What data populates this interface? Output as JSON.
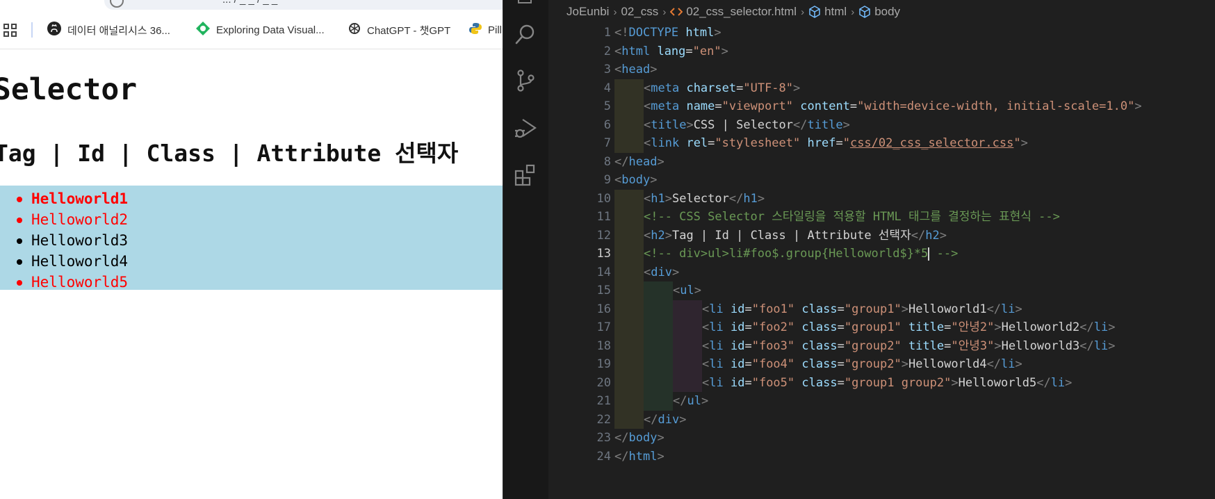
{
  "browser": {
    "url_text": "... / _ _ / _ _",
    "bookmarks": [
      {
        "label": "데이터 애널리시스 36...",
        "icon": "github-icon"
      },
      {
        "label": "Exploring Data Visual...",
        "icon": "green-diamond-icon"
      },
      {
        "label": "ChatGPT - 챗GPT",
        "icon": "openai-icon"
      },
      {
        "label": "Pill",
        "icon": "python-icon"
      }
    ],
    "page": {
      "h1": "Selector",
      "h2": "Tag | Id | Class | Attribute 선택자",
      "list_bg": "#add8e6",
      "items": [
        {
          "text": "Helloworld1",
          "color": "#ff0000",
          "bold": true
        },
        {
          "text": "Helloworld2",
          "color": "#ff0000",
          "bold": false
        },
        {
          "text": "Helloworld3",
          "color": "#000000",
          "bold": false
        },
        {
          "text": "Helloworld4",
          "color": "#000000",
          "bold": false
        },
        {
          "text": "Helloworld5",
          "color": "#ff0000",
          "bold": false
        }
      ]
    }
  },
  "vscode": {
    "breadcrumbs": [
      "JoEunbi",
      "02_css",
      "02_css_selector.html",
      "html",
      "body"
    ],
    "active_line": 13,
    "lines": [
      {
        "n": 1,
        "indent": 0,
        "tokens": [
          [
            "p",
            "<!"
          ],
          [
            "t",
            "DOCTYPE"
          ],
          [
            "x",
            " "
          ],
          [
            "a",
            "html"
          ],
          [
            "p",
            ">"
          ]
        ]
      },
      {
        "n": 2,
        "indent": 0,
        "tokens": [
          [
            "p",
            "<"
          ],
          [
            "t",
            "html"
          ],
          [
            "x",
            " "
          ],
          [
            "a",
            "lang"
          ],
          [
            "x",
            "="
          ],
          [
            "s",
            "\"en\""
          ],
          [
            "p",
            ">"
          ]
        ]
      },
      {
        "n": 3,
        "indent": 0,
        "tokens": [
          [
            "p",
            "<"
          ],
          [
            "t",
            "head"
          ],
          [
            "p",
            ">"
          ]
        ]
      },
      {
        "n": 4,
        "indent": 1,
        "tokens": [
          [
            "p",
            "<"
          ],
          [
            "t",
            "meta"
          ],
          [
            "x",
            " "
          ],
          [
            "a",
            "charset"
          ],
          [
            "x",
            "="
          ],
          [
            "s",
            "\"UTF-8\""
          ],
          [
            "p",
            ">"
          ]
        ]
      },
      {
        "n": 5,
        "indent": 1,
        "tokens": [
          [
            "p",
            "<"
          ],
          [
            "t",
            "meta"
          ],
          [
            "x",
            " "
          ],
          [
            "a",
            "name"
          ],
          [
            "x",
            "="
          ],
          [
            "s",
            "\"viewport\""
          ],
          [
            "x",
            " "
          ],
          [
            "a",
            "content"
          ],
          [
            "x",
            "="
          ],
          [
            "s",
            "\"width=device-width, initial-scale=1.0\""
          ],
          [
            "p",
            ">"
          ]
        ]
      },
      {
        "n": 6,
        "indent": 1,
        "tokens": [
          [
            "p",
            "<"
          ],
          [
            "t",
            "title"
          ],
          [
            "p",
            ">"
          ],
          [
            "x",
            "CSS | Selector"
          ],
          [
            "p",
            "</"
          ],
          [
            "t",
            "title"
          ],
          [
            "p",
            ">"
          ]
        ]
      },
      {
        "n": 7,
        "indent": 1,
        "tokens": [
          [
            "p",
            "<"
          ],
          [
            "t",
            "link"
          ],
          [
            "x",
            " "
          ],
          [
            "a",
            "rel"
          ],
          [
            "x",
            "="
          ],
          [
            "s",
            "\"stylesheet\""
          ],
          [
            "x",
            " "
          ],
          [
            "a",
            "href"
          ],
          [
            "x",
            "="
          ],
          [
            "s",
            "\""
          ],
          [
            "su",
            "css/02_css_selector.css"
          ],
          [
            "s",
            "\""
          ],
          [
            "p",
            ">"
          ]
        ]
      },
      {
        "n": 8,
        "indent": 0,
        "tokens": [
          [
            "p",
            "</"
          ],
          [
            "t",
            "head"
          ],
          [
            "p",
            ">"
          ]
        ]
      },
      {
        "n": 9,
        "indent": 0,
        "tokens": [
          [
            "p",
            "<"
          ],
          [
            "t",
            "body"
          ],
          [
            "p",
            ">"
          ]
        ]
      },
      {
        "n": 10,
        "indent": 1,
        "tokens": [
          [
            "p",
            "<"
          ],
          [
            "t",
            "h1"
          ],
          [
            "p",
            ">"
          ],
          [
            "x",
            "Selector"
          ],
          [
            "p",
            "</"
          ],
          [
            "t",
            "h1"
          ],
          [
            "p",
            ">"
          ]
        ]
      },
      {
        "n": 11,
        "indent": 1,
        "tokens": [
          [
            "c",
            "<!-- CSS Selector 스타일링을 적용할 HTML 태그를 결정하는 표현식 -->"
          ]
        ]
      },
      {
        "n": 12,
        "indent": 1,
        "tokens": [
          [
            "p",
            "<"
          ],
          [
            "t",
            "h2"
          ],
          [
            "p",
            ">"
          ],
          [
            "x",
            "Tag | Id | Class | Attribute 선택자"
          ],
          [
            "p",
            "</"
          ],
          [
            "t",
            "h2"
          ],
          [
            "p",
            ">"
          ]
        ]
      },
      {
        "n": 13,
        "indent": 1,
        "tokens": [
          [
            "c",
            "<!-- div>ul>li#foo$.group{Helloworld$}*5"
          ],
          [
            "cursor",
            ""
          ],
          [
            "c",
            " -->"
          ]
        ]
      },
      {
        "n": 14,
        "indent": 1,
        "tokens": [
          [
            "p",
            "<"
          ],
          [
            "t",
            "div"
          ],
          [
            "p",
            ">"
          ]
        ]
      },
      {
        "n": 15,
        "indent": 2,
        "tokens": [
          [
            "p",
            "<"
          ],
          [
            "t",
            "ul"
          ],
          [
            "p",
            ">"
          ]
        ]
      },
      {
        "n": 16,
        "indent": 3,
        "tokens": [
          [
            "p",
            "<"
          ],
          [
            "t",
            "li"
          ],
          [
            "x",
            " "
          ],
          [
            "a",
            "id"
          ],
          [
            "x",
            "="
          ],
          [
            "s",
            "\"foo1\""
          ],
          [
            "x",
            " "
          ],
          [
            "a",
            "class"
          ],
          [
            "x",
            "="
          ],
          [
            "s",
            "\"group1\""
          ],
          [
            "p",
            ">"
          ],
          [
            "x",
            "Helloworld1"
          ],
          [
            "p",
            "</"
          ],
          [
            "t",
            "li"
          ],
          [
            "p",
            ">"
          ]
        ]
      },
      {
        "n": 17,
        "indent": 3,
        "tokens": [
          [
            "p",
            "<"
          ],
          [
            "t",
            "li"
          ],
          [
            "x",
            " "
          ],
          [
            "a",
            "id"
          ],
          [
            "x",
            "="
          ],
          [
            "s",
            "\"foo2\""
          ],
          [
            "x",
            " "
          ],
          [
            "a",
            "class"
          ],
          [
            "x",
            "="
          ],
          [
            "s",
            "\"group1\""
          ],
          [
            "x",
            " "
          ],
          [
            "a",
            "title"
          ],
          [
            "x",
            "="
          ],
          [
            "s",
            "\"안녕2\""
          ],
          [
            "p",
            ">"
          ],
          [
            "x",
            "Helloworld2"
          ],
          [
            "p",
            "</"
          ],
          [
            "t",
            "li"
          ],
          [
            "p",
            ">"
          ]
        ]
      },
      {
        "n": 18,
        "indent": 3,
        "tokens": [
          [
            "p",
            "<"
          ],
          [
            "t",
            "li"
          ],
          [
            "x",
            " "
          ],
          [
            "a",
            "id"
          ],
          [
            "x",
            "="
          ],
          [
            "s",
            "\"foo3\""
          ],
          [
            "x",
            " "
          ],
          [
            "a",
            "class"
          ],
          [
            "x",
            "="
          ],
          [
            "s",
            "\"group2\""
          ],
          [
            "x",
            " "
          ],
          [
            "a",
            "title"
          ],
          [
            "x",
            "="
          ],
          [
            "s",
            "\"안녕3\""
          ],
          [
            "p",
            ">"
          ],
          [
            "x",
            "Helloworld3"
          ],
          [
            "p",
            "</"
          ],
          [
            "t",
            "li"
          ],
          [
            "p",
            ">"
          ]
        ]
      },
      {
        "n": 19,
        "indent": 3,
        "tokens": [
          [
            "p",
            "<"
          ],
          [
            "t",
            "li"
          ],
          [
            "x",
            " "
          ],
          [
            "a",
            "id"
          ],
          [
            "x",
            "="
          ],
          [
            "s",
            "\"foo4\""
          ],
          [
            "x",
            " "
          ],
          [
            "a",
            "class"
          ],
          [
            "x",
            "="
          ],
          [
            "s",
            "\"group2\""
          ],
          [
            "p",
            ">"
          ],
          [
            "x",
            "Helloworld4"
          ],
          [
            "p",
            "</"
          ],
          [
            "t",
            "li"
          ],
          [
            "p",
            ">"
          ]
        ]
      },
      {
        "n": 20,
        "indent": 3,
        "tokens": [
          [
            "p",
            "<"
          ],
          [
            "t",
            "li"
          ],
          [
            "x",
            " "
          ],
          [
            "a",
            "id"
          ],
          [
            "x",
            "="
          ],
          [
            "s",
            "\"foo5\""
          ],
          [
            "x",
            " "
          ],
          [
            "a",
            "class"
          ],
          [
            "x",
            "="
          ],
          [
            "s",
            "\"group1 group2\""
          ],
          [
            "p",
            ">"
          ],
          [
            "x",
            "Helloworld5"
          ],
          [
            "p",
            "</"
          ],
          [
            "t",
            "li"
          ],
          [
            "p",
            ">"
          ]
        ]
      },
      {
        "n": 21,
        "indent": 2,
        "tokens": [
          [
            "p",
            "</"
          ],
          [
            "t",
            "ul"
          ],
          [
            "p",
            ">"
          ]
        ]
      },
      {
        "n": 22,
        "indent": 1,
        "tokens": [
          [
            "p",
            "</"
          ],
          [
            "t",
            "div"
          ],
          [
            "p",
            ">"
          ]
        ]
      },
      {
        "n": 23,
        "indent": 0,
        "tokens": [
          [
            "p",
            "</"
          ],
          [
            "t",
            "body"
          ],
          [
            "p",
            ">"
          ]
        ]
      },
      {
        "n": 24,
        "indent": 0,
        "tokens": [
          [
            "p",
            "</"
          ],
          [
            "t",
            "html"
          ],
          [
            "p",
            ">"
          ]
        ]
      }
    ]
  }
}
